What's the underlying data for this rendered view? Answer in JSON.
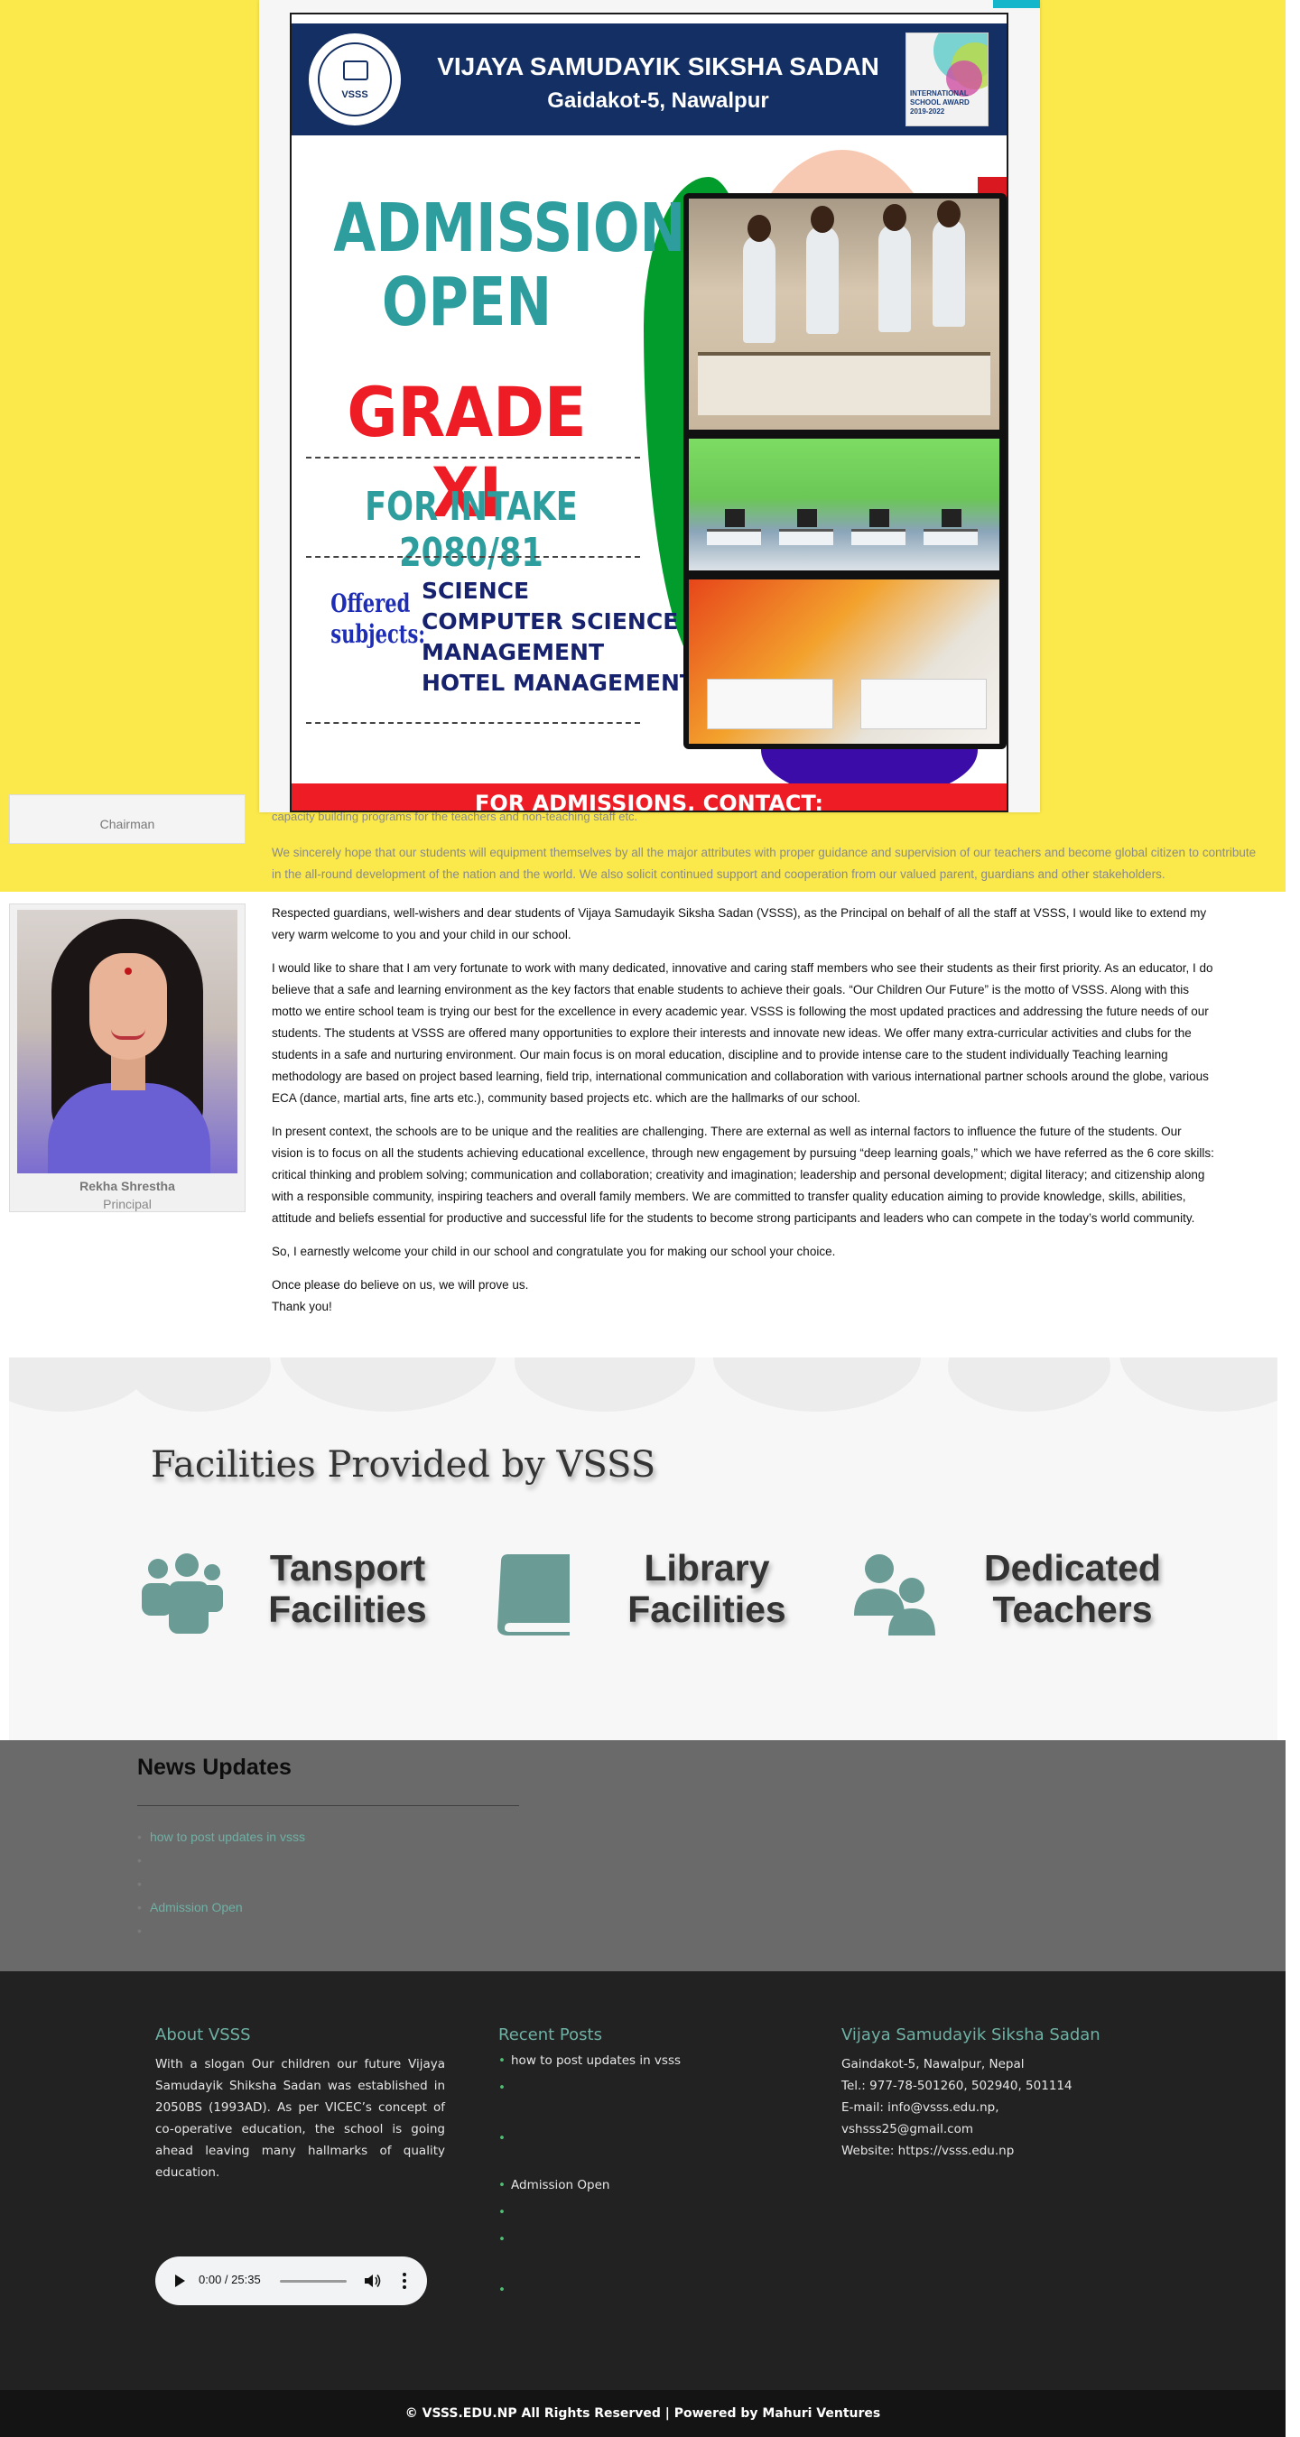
{
  "chairman": {
    "role": "Chairman",
    "text_partial": "capacity building programs for the teachers and non-teaching staff etc.",
    "text_hope": "We sincerely hope that our students will equipment themselves by all the major attributes with proper guidance and supervision of our teachers and become global citizen to contribute in the all-round development of the nation and the world. We also solicit continued support and cooperation from our valued parent, guardians and other stakeholders."
  },
  "principal": {
    "name": "Rekha Shrestha",
    "role": "Principal",
    "paragraphs": [
      "Respected guardians, well-wishers and dear students of Vijaya Samudayik Siksha Sadan (VSSS), as the Principal on behalf of all the staff at VSSS, I would like to extend my very warm welcome to you and your child in our school.",
      "I would like to share that I am very fortunate to work with many dedicated, innovative and caring staff members who see their students as their first priority. As an educator, I do believe that a safe and learning environment as the key factors that enable students to achieve their goals. “Our Children Our Future” is the motto of VSSS. Along with this motto we entire school team is trying our best for the excellence in every academic year. VSSS is following the most updated practices and addressing the future needs of our students. The students at VSSS are offered many opportunities to explore their interests and innovate new ideas. We offer many extra-curricular activities and clubs for the students in a safe and nurturing environment. Our main focus is on moral education, discipline and to provide intense care to the student individually Teaching learning methodology are based on project based learning, field trip, international communication and collaboration with various international partner schools around the globe, various ECA (dance, martial arts, fine arts etc.), community based projects etc. which are the hallmarks of our school.",
      "In present context, the schools are to be unique and the realities are challenging. There are external as well as internal factors to influence the future of the students. Our vision is to focus on all the students achieving educational excellence, through new engagement by pursuing “deep learning goals,” which we have referred as the 6 core skills: critical thinking and problem solving; communication and collaboration; creativity and imagination; leadership and personal development; digital literacy; and citizenship along with a responsible community, inspiring teachers and overall family members. We are committed to transfer quality education aiming to provide knowledge, skills, abilities, attitude and beliefs essential for productive and successful life for the students to become strong participants and leaders who can compete in the today’s world community.",
      "So, I earnestly welcome your child in our school and congratulate you for making our school your choice."
    ],
    "closing_1": "Once please do believe on us, we will prove us.",
    "closing_2": "Thank you!"
  },
  "facilities": {
    "title": "Facilities Provided by VSSS",
    "items": [
      {
        "line1": "Tansport",
        "line2": "Facilities",
        "icon": "group-icon"
      },
      {
        "line1": "Library",
        "line2": "Facilities",
        "icon": "book-icon"
      },
      {
        "line1": "Dedicated",
        "line2": "Teachers",
        "icon": "users-icon"
      }
    ],
    "icon_color": "#6a9b95"
  },
  "news": {
    "title": "News Updates",
    "items": [
      "how to post updates in vsss",
      "",
      "",
      "Admission Open",
      ""
    ]
  },
  "footer": {
    "about_title": "About VSSS",
    "about_text": "With a slogan  Our children our future  Vijaya Samudayik Shiksha Sadan was established in 2050BS (1993AD). As per VICEC’s concept of co-operative education, the school is going ahead leaving many hallmarks of quality education.",
    "posts_title": "Recent Posts",
    "posts": [
      "how to post updates in vsss",
      "",
      "",
      "Admission Open",
      "",
      "",
      ""
    ],
    "contact_title": "Vijaya Samudayik Siksha Sadan",
    "contact_lines": [
      "Gaindakot-5, Nawalpur, Nepal",
      "Tel.: 977-78-501260, 502940, 501114",
      "E-mail: info@vsss.edu.np, vshsss25@gmail.com",
      "Website: https://vsss.edu.np"
    ],
    "audio_time": "0:00 / 25:35",
    "copyright": "© VSSS.EDU.NP All Rights Reserved | Powered by Mahuri Ventures"
  },
  "flyer": {
    "school_name": "VIJAYA SAMUDAYIK SIKSHA SADAN",
    "location": "Gaidakot-5, Nawalpur",
    "seal_text": "VSSS",
    "award_label": "INTERNATIONAL SCHOOL AWARD 2019-2022",
    "headline_1": "ADMISSION",
    "headline_2": "OPEN",
    "grade": "GRADE XI",
    "intake": "FOR INTAKE 2080/81",
    "offered_1": "Offered",
    "offered_2": "subjects:",
    "subjects": [
      "SCIENCE",
      "COMPUTER SCIENCE",
      "MANAGEMENT",
      "HOTEL MANAGEMENT"
    ],
    "contact": "FOR ADMISSIONS, CONTACT:"
  },
  "colors": {
    "accent": "#6fb0a4",
    "yellow": "#fbe94c",
    "footer_bg": "#222222",
    "teal_text": "#2e9d9d",
    "red": "#ee1c25",
    "navy": "#132f63",
    "modal_close": "#14b6cc"
  }
}
